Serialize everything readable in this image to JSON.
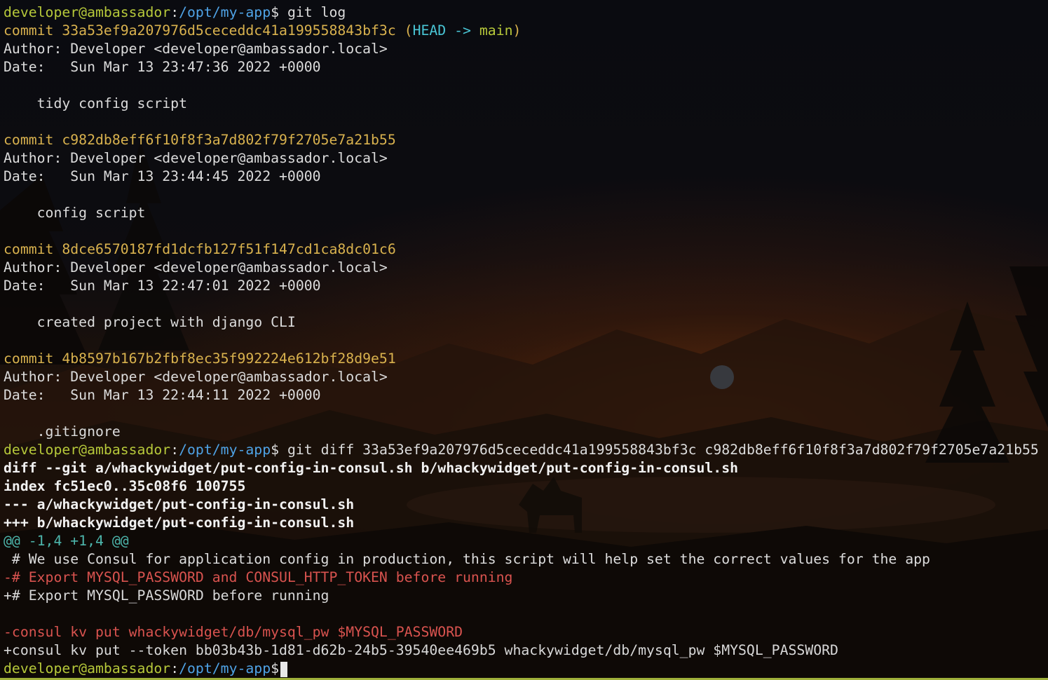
{
  "colors": {
    "prompt_user": "#b6c83a",
    "prompt_path": "#4fa3e6",
    "commit_hash": "#d9b24e",
    "head_ref": "#49c6d6",
    "branch_ref": "#b6c83a",
    "hunk_header": "#4db6ac",
    "deleted_line": "#d9534f",
    "background_sky": "#0a0b10",
    "background_sunset": "#2a150a"
  },
  "prompt": {
    "user_host": "developer@ambassador",
    "separator": ":",
    "path": "/opt/my-app",
    "symbol": "$"
  },
  "commands": {
    "git_log": " git log",
    "git_diff": " git diff 33a53ef9a207976d5ceceddc41a199558843bf3c c982db8eff6f10f8f3a7d802f79f2705e7a21b55"
  },
  "git_log": {
    "commits": [
      {
        "commit_line": "commit 33a53ef9a207976d5ceceddc41a199558843bf3c",
        "ref_open": " (",
        "head": "HEAD ->",
        "branch": " main",
        "ref_close": ")",
        "author": "Author: Developer <developer@ambassador.local>",
        "date": "Date:   Sun Mar 13 23:47:36 2022 +0000",
        "message": "    tidy config script"
      },
      {
        "commit_line": "commit c982db8eff6f10f8f3a7d802f79f2705e7a21b55",
        "author": "Author: Developer <developer@ambassador.local>",
        "date": "Date:   Sun Mar 13 23:44:45 2022 +0000",
        "message": "    config script"
      },
      {
        "commit_line": "commit 8dce6570187fd1dcfb127f51f147cd1ca8dc01c6",
        "author": "Author: Developer <developer@ambassador.local>",
        "date": "Date:   Sun Mar 13 22:47:01 2022 +0000",
        "message": "    created project with django CLI"
      },
      {
        "commit_line": "commit 4b8597b167b2fbf8ec35f992224e612bf28d9e51",
        "author": "Author: Developer <developer@ambassador.local>",
        "date": "Date:   Sun Mar 13 22:44:11 2022 +0000",
        "message": "    .gitignore"
      }
    ]
  },
  "git_diff": {
    "header": "diff --git a/whackywidget/put-config-in-consul.sh b/whackywidget/put-config-in-consul.sh",
    "index": "index fc51ec0..35c08f6 100755",
    "old_file": "--- a/whackywidget/put-config-in-consul.sh",
    "new_file": "+++ b/whackywidget/put-config-in-consul.sh",
    "hunk": "@@ -1,4 +1,4 @@",
    "context_line": " # We use Consul for application config in production, this script will help set the correct values for the app",
    "removed_comment": "-# Export MYSQL_PASSWORD and CONSUL_HTTP_TOKEN before running",
    "added_comment": "+# Export MYSQL_PASSWORD before running",
    "removed_command": "-consul kv put whackywidget/db/mysql_pw $MYSQL_PASSWORD",
    "added_command": "+consul kv put --token bb03b43b-1d81-d62b-24b5-39540ee469b5 whackywidget/db/mysql_pw $MYSQL_PASSWORD"
  },
  "icons": {
    "cursor": "block-cursor-icon"
  }
}
